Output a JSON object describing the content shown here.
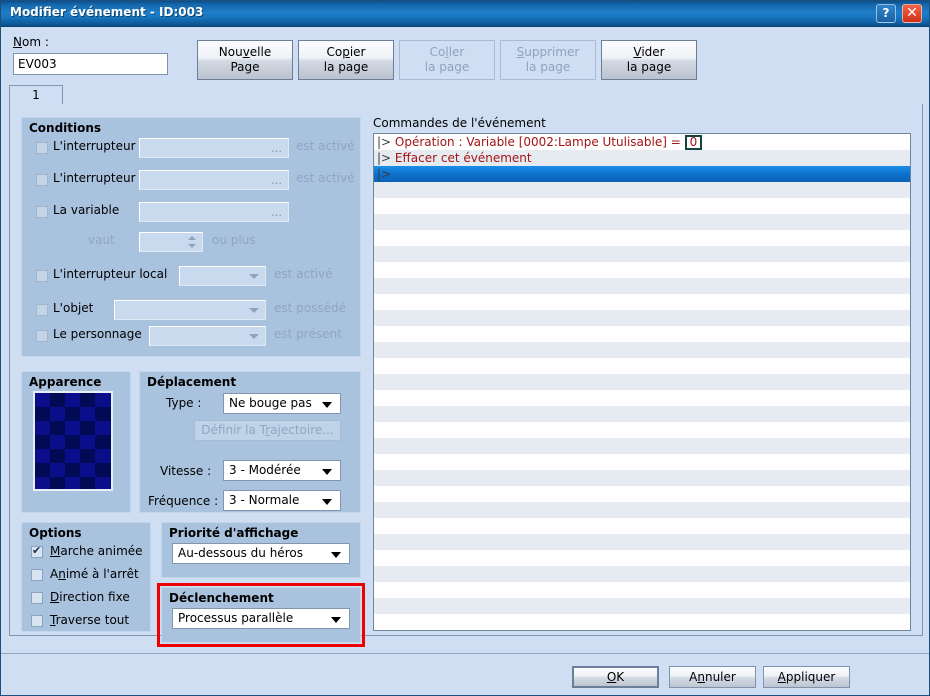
{
  "window": {
    "title": "Modifier événement - ID:003",
    "help_button": "?",
    "close_button": "✕"
  },
  "top": {
    "name_label": "Nom :",
    "name_value": "EV003",
    "page_buttons": [
      {
        "line1": "Nouvelle",
        "line2": "Page",
        "enabled": true
      },
      {
        "line1": "Copier",
        "line2": "la page",
        "enabled": true
      },
      {
        "line1": "Coller",
        "line2": "la page",
        "enabled": false
      },
      {
        "line1": "Supprimer",
        "line2": "la page",
        "enabled": false
      },
      {
        "line1": "Vider",
        "line2": "la page",
        "enabled": true
      }
    ]
  },
  "tabs": [
    {
      "label": "1",
      "active": true
    }
  ],
  "conditions": {
    "legend": "Conditions",
    "rows": [
      {
        "label": "L'interrupteur",
        "checked": false,
        "field": "",
        "suffix": "est activé"
      },
      {
        "label": "L'interrupteur",
        "checked": false,
        "field": "",
        "suffix": "est activé"
      },
      {
        "label": "La variable",
        "checked": false,
        "field": "",
        "suffix": ""
      },
      {
        "label": "vaut",
        "value": "",
        "suffix": "ou plus"
      },
      {
        "label": "L'interrupteur local",
        "checked": false,
        "field": "",
        "suffix": "est activé"
      },
      {
        "label": "L'objet",
        "checked": false,
        "field": "",
        "suffix": "est possédé"
      },
      {
        "label": "Le personnage",
        "checked": false,
        "field": "",
        "suffix": "est présent"
      }
    ]
  },
  "apparence": {
    "legend": "Apparence"
  },
  "deplacement": {
    "legend": "Déplacement",
    "type_label": "Type :",
    "type_value": "Ne bouge pas",
    "trajectory_button": "Définir la Trajectoire...",
    "speed_label": "Vitesse :",
    "speed_value": "3 - Modérée",
    "freq_label": "Fréquence :",
    "freq_value": "3 - Normale"
  },
  "options": {
    "legend": "Options",
    "items": [
      {
        "label": "Marche animée",
        "checked": true
      },
      {
        "label": "Animé à l'arrêt",
        "checked": false
      },
      {
        "label": "Direction fixe",
        "checked": false
      },
      {
        "label": "Traverse tout",
        "checked": false
      }
    ]
  },
  "priorite": {
    "legend": "Priorité d'affichage",
    "value": "Au-dessous du héros"
  },
  "declenchement": {
    "legend": "Déclenchement",
    "value": "Processus parallèle",
    "highlight_color": "#ee0000"
  },
  "commands": {
    "title": "Commandes de l'événement",
    "rows": [
      {
        "prefix": "|>",
        "text": "Opération : Variable [0002:Lampe Utulisable] =",
        "boxed_value": "0",
        "selected": false
      },
      {
        "prefix": "|>",
        "text": "Effacer cet événement",
        "selected": false
      },
      {
        "prefix": "|>",
        "text": "",
        "selected": true
      }
    ],
    "empty_row_count": 28
  },
  "footer": {
    "ok": "OK",
    "cancel": "Annuler",
    "apply": "Appliquer"
  }
}
